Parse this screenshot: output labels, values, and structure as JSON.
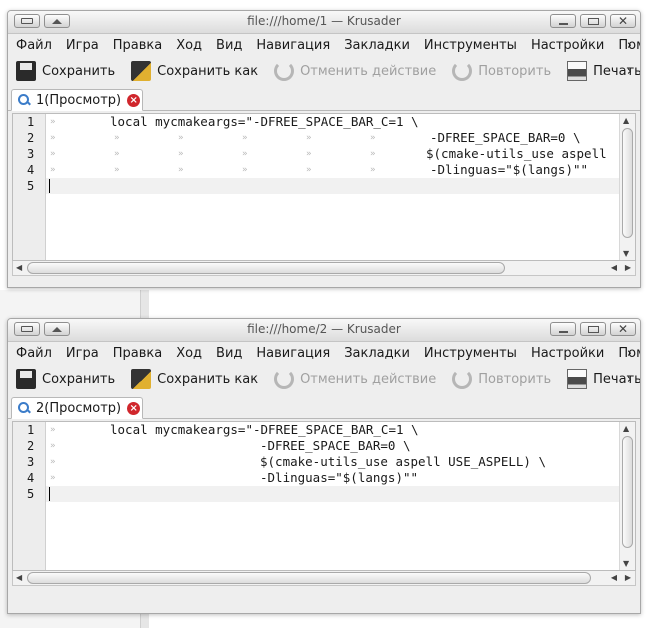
{
  "colors": {
    "accent": "#3b7cc9",
    "close_red": "#d0262c",
    "disabled_text": "#a0a0a0"
  },
  "icons": {
    "save": "save-icon",
    "save_as": "save-as-icon",
    "undo": "undo-icon",
    "redo": "redo-icon",
    "print": "print-icon",
    "preview": "magnifier-icon",
    "close_tab": "close-tab-icon"
  },
  "menu": [
    "Файл",
    "Игра",
    "Правка",
    "Ход",
    "Вид",
    "Навигация",
    "Закладки",
    "Инструменты",
    "Настройки",
    "Помощь"
  ],
  "toolbar": {
    "save": "Сохранить",
    "save_as": "Сохранить как",
    "undo": "Отменить действие",
    "redo": "Повторить",
    "print": "Печать"
  },
  "overflow": "›",
  "windows": [
    {
      "title": "file:///home/1 — Krusader",
      "tab": "1(Просмотр)",
      "line_numbers": [
        "1",
        "2",
        "3",
        "4",
        "5"
      ],
      "lines": [
        "local mycmakeargs=\"-DFREE_SPACE_BAR_C=1 \\",
        "-DFREE_SPACE_BAR=0 \\",
        "$(cmake-utils_use aspell",
        "-Dlinguas=\"$(langs)\"\"",
        ""
      ]
    },
    {
      "title": "file:///home/2 — Krusader",
      "tab": "2(Просмотр)",
      "line_numbers": [
        "1",
        "2",
        "3",
        "4",
        "5"
      ],
      "lines": [
        "local mycmakeargs=\"-DFREE_SPACE_BAR_C=1 \\",
        "-DFREE_SPACE_BAR=0 \\",
        "$(cmake-utils_use aspell USE_ASPELL) \\",
        "-Dlinguas=\"$(langs)\"\"",
        ""
      ]
    }
  ]
}
